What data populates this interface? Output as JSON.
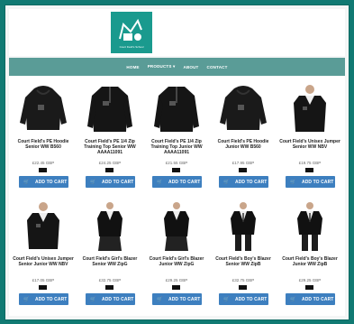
{
  "logo": {
    "text": "Court Field's School"
  },
  "nav": {
    "items": [
      "HOME",
      "PRODUCTS ▾",
      "ABOUT",
      "CONTACT"
    ]
  },
  "products": [
    {
      "name": "Court Field's PE Hoodie Senior WW B560",
      "price": "£22.45 GBP",
      "kind": "hoodie"
    },
    {
      "name": "Court Field's PE 1/4 Zip Training Top Senior WW AAAA11091",
      "price": "£24.25 GBP",
      "kind": "zip"
    },
    {
      "name": "Court Field's PE 1/4 Zip Training Top Junior WW AAAA11091",
      "price": "£21.55 GBP",
      "kind": "zip"
    },
    {
      "name": "Court Field's PE Hoodie Junior WW B560",
      "price": "£17.95 GBP",
      "kind": "hoodie"
    },
    {
      "name": "Court Field's Unisex Jumper Senior WW NBV",
      "price": "£19.75 GBP",
      "kind": "jumper"
    },
    {
      "name": "Court Field's Unisex Jumper Senior Junior WW NBV",
      "price": "£17.05 GBP",
      "kind": "jumper"
    },
    {
      "name": "Court Field's Girl's Blazer Senior WW ZipG",
      "price": "£32.75 GBP",
      "kind": "girlblazer"
    },
    {
      "name": "Court Field's Girl's Blazer Junior WW ZipG",
      "price": "£29.25 GBP",
      "kind": "girlblazer"
    },
    {
      "name": "Court Field's Boy's Blazer Senior WW ZipB",
      "price": "£32.75 GBP",
      "kind": "boyblazer"
    },
    {
      "name": "Court Field's Boy's Blazer Junior WW ZipB",
      "price": "£29.25 GBP",
      "kind": "boyblazer"
    }
  ],
  "cart_label": "ADD TO CART",
  "colors": {
    "accent": "#117a73",
    "nav": "#5a9c97",
    "button": "#3d7fbf"
  }
}
